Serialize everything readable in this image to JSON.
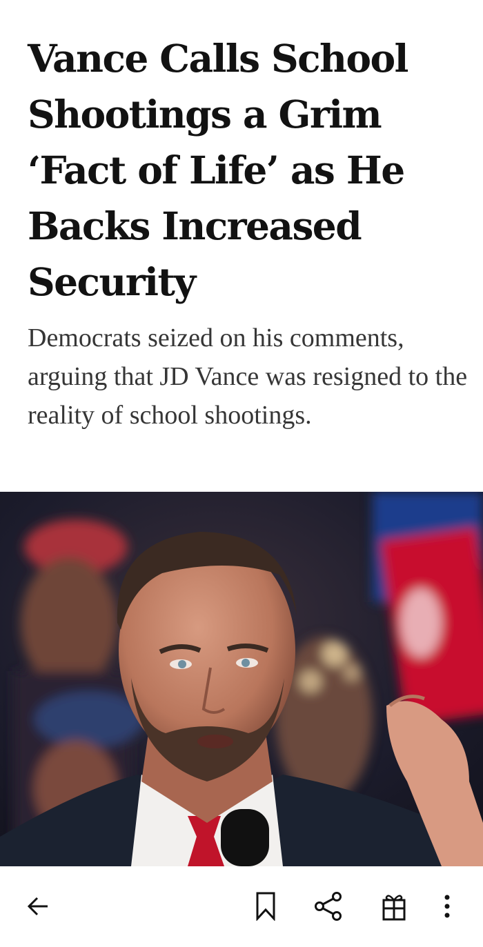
{
  "article": {
    "headline": "Vance Calls School Shootings a Grim ‘Fact of Life’ as He Backs Increased Security",
    "summary": "Democrats seized on his comments, arguing that JD Vance was resigned to the reality of school shootings."
  },
  "photo": {
    "description_icon": "photo-icon"
  },
  "toolbar": {
    "icons": [
      "back-arrow-icon",
      "bookmark-icon",
      "share-icon",
      "gift-icon",
      "more-vertical-icon"
    ]
  },
  "colors": {
    "text": "#121212",
    "summary_text": "#363636",
    "background": "#ffffff",
    "sign_red": "#c8102e",
    "tie_red": "#c0142a"
  }
}
